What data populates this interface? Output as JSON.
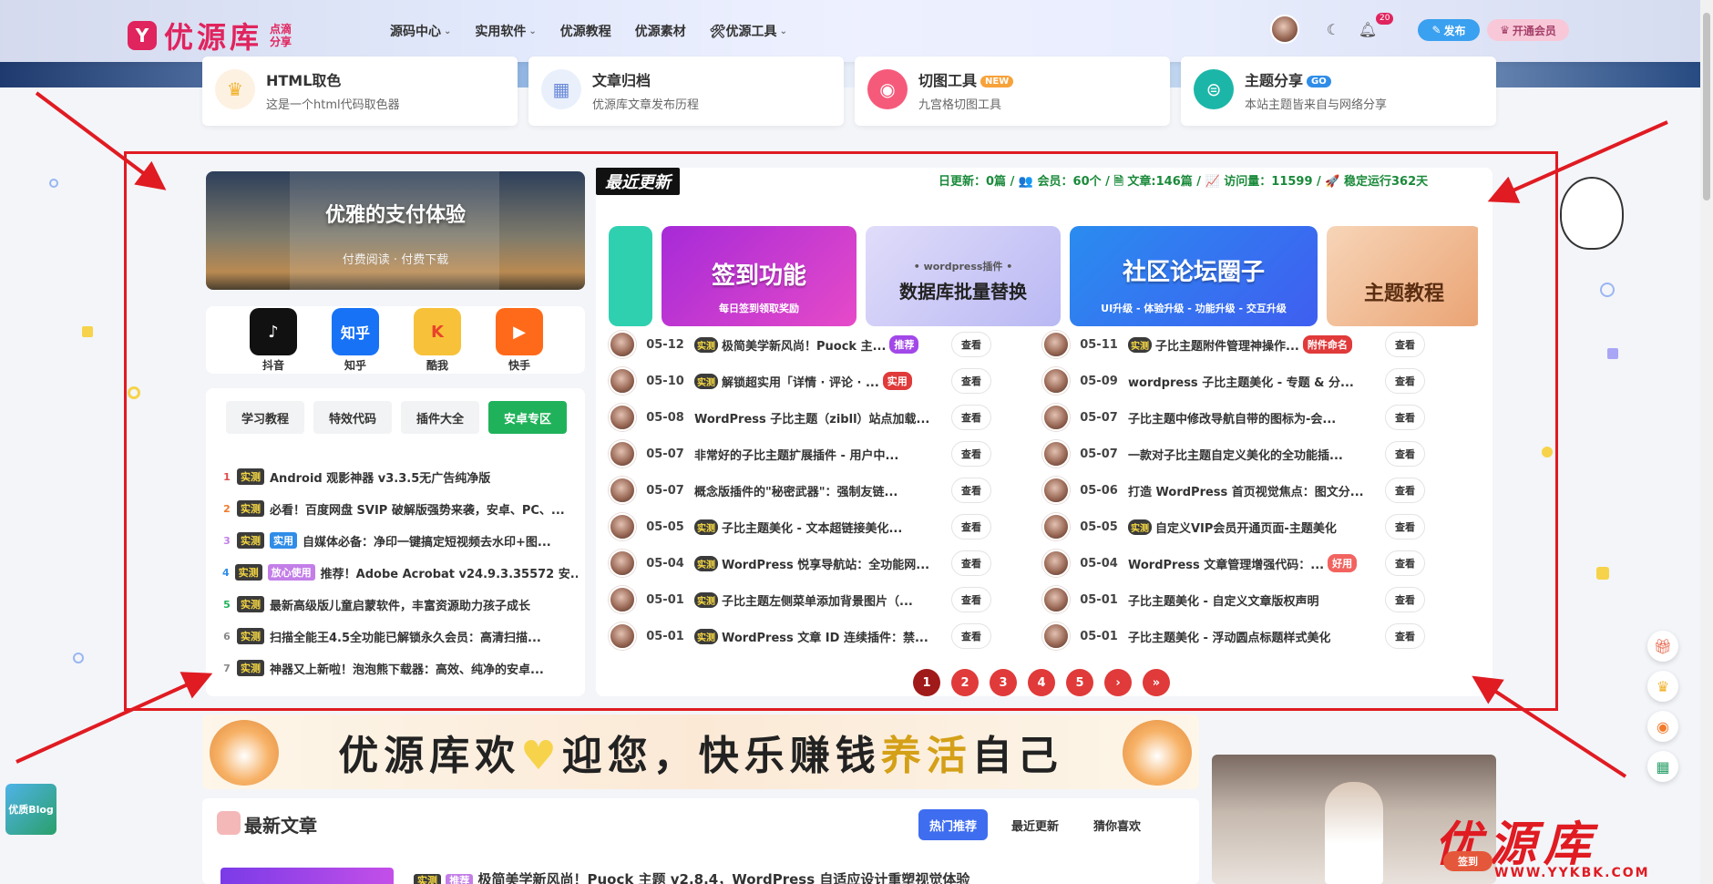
{
  "header": {
    "logo_text": "优源库",
    "logo_sub": "点滴分享",
    "nav": [
      {
        "label": "源码中心",
        "dropdown": true
      },
      {
        "label": "实用软件",
        "dropdown": true
      },
      {
        "label": "优源教程",
        "dropdown": false
      },
      {
        "label": "优源素材",
        "dropdown": false
      },
      {
        "label": "🛠优源工具",
        "dropdown": true
      }
    ],
    "notification_count": "20",
    "publish_label": "发布",
    "vip_label": "开通会员"
  },
  "tools": [
    {
      "title": "HTML取色",
      "desc": "这是一个html代码取色器",
      "badge": "",
      "icon": "crown-icon"
    },
    {
      "title": "文章归档",
      "desc": "优源库文章发布历程",
      "badge": "",
      "icon": "chart-icon"
    },
    {
      "title": "切图工具",
      "desc": "九宫格切图工具",
      "badge": "NEW",
      "icon": "pig-icon"
    },
    {
      "title": "主题分享",
      "desc": "本站主题皆来自与网络分享",
      "badge": "GO",
      "icon": "share-icon"
    }
  ],
  "promo": {
    "title": "优雅的支付体验",
    "subtitle": "付费阅读 · 付费下载"
  },
  "apps": [
    {
      "label": "抖音",
      "color": "#111111",
      "glyph": "♪"
    },
    {
      "label": "知乎",
      "color": "#1772f6",
      "glyph": "知乎"
    },
    {
      "label": "酷我",
      "color": "#f7c23a",
      "glyph": "K"
    },
    {
      "label": "快手",
      "color": "#ff6a1a",
      "glyph": "▶"
    }
  ],
  "left_tabs": [
    "学习教程",
    "特效代码",
    "插件大全",
    "安卓专区"
  ],
  "left_active_tab": "安卓专区",
  "left_list": [
    {
      "num": "1",
      "tags": [
        {
          "text": "实测",
          "style": "t-dark"
        }
      ],
      "title": "Android 观影神器 v3.3.5无广告纯净版"
    },
    {
      "num": "2",
      "tags": [
        {
          "text": "实测",
          "style": "t-dark"
        }
      ],
      "title": "必看！百度网盘 SVIP 破解版强势来袭，安卓、PC、..."
    },
    {
      "num": "3",
      "tags": [
        {
          "text": "实测",
          "style": "t-dark"
        },
        {
          "text": "实用",
          "style": "t-blue"
        }
      ],
      "title": "自媒体必备：净印一键搞定短视频去水印+图..."
    },
    {
      "num": "4",
      "tags": [
        {
          "text": "实测",
          "style": "t-dark"
        },
        {
          "text": "放心使用",
          "style": "t-purple"
        }
      ],
      "title": "推荐！Adobe Acrobat v24.9.3.35572 安..."
    },
    {
      "num": "5",
      "tags": [
        {
          "text": "实测",
          "style": "t-dark"
        }
      ],
      "title": "最新高级版儿童启蒙软件，丰富资源助力孩子成长"
    },
    {
      "num": "6",
      "tags": [
        {
          "text": "实测",
          "style": "t-dark"
        }
      ],
      "title": "扫描全能王4.5全功能已解锁永久会员：高清扫描..."
    },
    {
      "num": "7",
      "tags": [
        {
          "text": "实测",
          "style": "t-dark"
        }
      ],
      "title": "神器又上新啦！泡泡熊下载器：高效、纯净的安卓..."
    }
  ],
  "main": {
    "title": "最近更新",
    "stats": "日更新：0篇 / 👥 会员：60个 / 🗎 文章:146篇 / 📈 访问量：11599 / 🚀 稳定运行362天",
    "slides": [
      {
        "title": "",
        "sub": "",
        "color": "#2fd0b0"
      },
      {
        "title": "签到功能",
        "sub": "每日签到领取奖励",
        "color": "#c23bd8"
      },
      {
        "title": "数据库批量替换",
        "sub": "• wordpress插件 •",
        "color": "#a7a6f2"
      },
      {
        "title": "社区论坛圈子",
        "sub": "UI升级 - 体验升级 - 功能升级 - 交互升级",
        "color": "#2f7ff0"
      },
      {
        "title": "主题教程",
        "sub": "",
        "color": "#f1b98a"
      }
    ],
    "view_label": "查看",
    "posts_left": [
      {
        "date": "05-12",
        "shi": true,
        "title": "极简美学新风尚！Puock 主...",
        "badge": "推荐",
        "badge_style": "b-purple"
      },
      {
        "date": "05-10",
        "shi": true,
        "title": "解锁超实用「详情 · 评论 · ...",
        "badge": "实用",
        "badge_style": "b-red"
      },
      {
        "date": "05-08",
        "shi": false,
        "title": "WordPress 子比主题（zibll）站点加载...",
        "badge": "",
        "badge_style": ""
      },
      {
        "date": "05-07",
        "shi": false,
        "title": "非常好的子比主题扩展插件 - 用户中...",
        "badge": "",
        "badge_style": ""
      },
      {
        "date": "05-07",
        "shi": false,
        "title": "概念版插件的\"秘密武器\"：强制友链...",
        "badge": "",
        "badge_style": ""
      },
      {
        "date": "05-05",
        "shi": true,
        "title": "子比主题美化 - 文本超链接美化...",
        "badge": "",
        "badge_style": ""
      },
      {
        "date": "05-04",
        "shi": true,
        "title": "WordPress 悦享导航站：全功能网...",
        "badge": "",
        "badge_style": ""
      },
      {
        "date": "05-01",
        "shi": true,
        "title": "子比主题左侧菜单添加背景图片（...",
        "badge": "",
        "badge_style": ""
      },
      {
        "date": "05-01",
        "shi": true,
        "title": "WordPress 文章 ID 连续插件：禁...",
        "badge": "",
        "badge_style": ""
      }
    ],
    "posts_right": [
      {
        "date": "05-11",
        "shi": true,
        "title": "子比主题附件管理神操作...",
        "badge": "附件命名",
        "badge_style": "b-red"
      },
      {
        "date": "05-09",
        "shi": false,
        "title": "wordpress 子比主题美化 - 专题 & 分...",
        "badge": "",
        "badge_style": ""
      },
      {
        "date": "05-07",
        "shi": false,
        "title": "子比主题中修改导航自带的图标为-会...",
        "badge": "",
        "badge_style": ""
      },
      {
        "date": "05-07",
        "shi": false,
        "title": "一款对子比主题自定义美化的全功能插...",
        "badge": "",
        "badge_style": ""
      },
      {
        "date": "05-06",
        "shi": false,
        "title": "打造 WordPress 首页视觉焦点：图文分...",
        "badge": "",
        "badge_style": ""
      },
      {
        "date": "05-05",
        "shi": true,
        "title": "自定义VIP会员开通页面-主题美化",
        "badge": "",
        "badge_style": ""
      },
      {
        "date": "05-04",
        "shi": false,
        "title": "WordPress 文章管理增强代码：...",
        "badge": "好用",
        "badge_style": "b-pink"
      },
      {
        "date": "05-01",
        "shi": false,
        "title": "子比主题美化 - 自定义文章版权声明",
        "badge": "",
        "badge_style": ""
      },
      {
        "date": "05-01",
        "shi": false,
        "title": "子比主题美化 - 浮动圆点标题样式美化",
        "badge": "",
        "badge_style": ""
      }
    ],
    "shi_label": "实测",
    "pagination": [
      "1",
      "2",
      "3",
      "4",
      "5",
      "›",
      "»"
    ]
  },
  "welcome": {
    "part1": "优源库欢",
    "heart": "♥",
    "part2": "迎您，快乐赚钱",
    "part3": "养活",
    "part4": "自己"
  },
  "articles": {
    "title": "最新文章",
    "tabs": [
      "热门推荐",
      "最近更新",
      "猜你喜欢"
    ],
    "active_tab": "热门推荐",
    "first_line": "极简美学新风尚！Puock 主题 v2.8.4，WordPress 自适应设计重塑视觉体验",
    "first_tags": [
      "实测",
      "推荐"
    ]
  },
  "watermark": {
    "text": "优源库",
    "url": "WWW.YYKBK.COM",
    "sign_label": "签到"
  },
  "blog_cube": "优质Blog",
  "colors": {
    "accent_red": "#e01b22",
    "green": "#20b25a",
    "brand_pink": "#e0245e"
  }
}
